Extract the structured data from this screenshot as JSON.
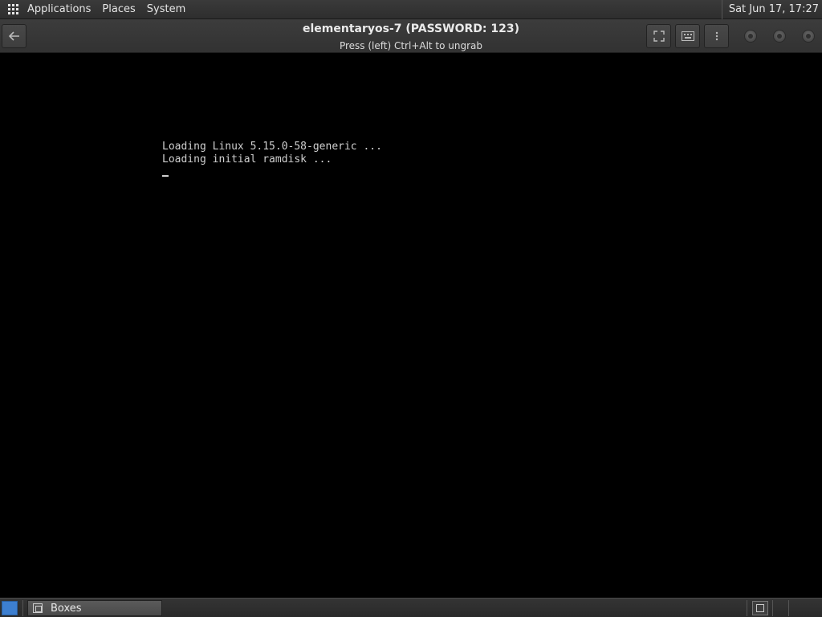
{
  "top_panel": {
    "menu": [
      "Applications",
      "Places",
      "System"
    ],
    "clock": "Sat Jun 17, 17:27"
  },
  "window": {
    "title": "elementaryos-7 (PASSWORD: 123)",
    "subtitle": "Press (left) Ctrl+Alt to ungrab",
    "buttons": {
      "back": "back-arrow-icon",
      "fullscreen": "fullscreen-icon",
      "keyboard": "keyboard-icon",
      "menu": "vertical-dots-icon"
    }
  },
  "console": {
    "lines": [
      "Loading Linux 5.15.0-58-generic ...",
      "Loading initial ramdisk ..."
    ]
  },
  "taskbar": {
    "items": [
      {
        "label": "Boxes"
      }
    ]
  },
  "colors": {
    "panel_bg": "#2e2e2e",
    "headerbar_bg": "#363636",
    "console_text": "#cfcfcf",
    "show_desktop": "#3d7fd0"
  }
}
